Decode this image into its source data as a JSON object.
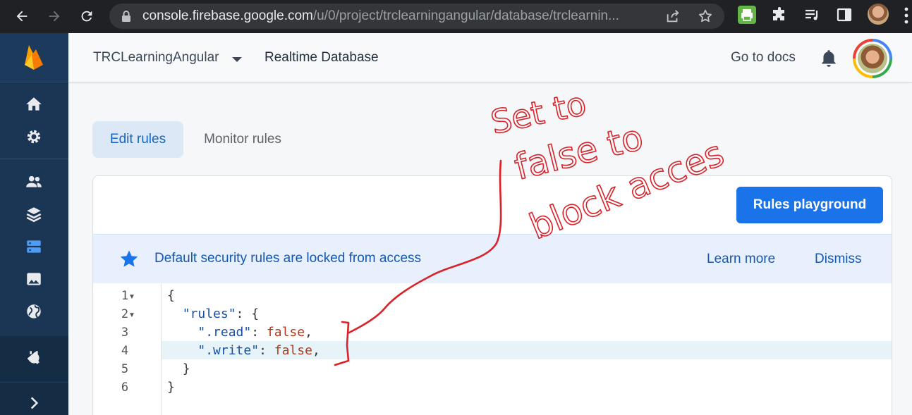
{
  "browser": {
    "url_host": "console.firebase.google.com",
    "url_path": "/u/0/project/trclearningangular/database/trclearnin..."
  },
  "header": {
    "project_name": "TRCLearningAngular",
    "section": "Realtime Database",
    "docs_link": "Go to docs"
  },
  "tabs": [
    {
      "label": "Edit rules",
      "active": true
    },
    {
      "label": "Monitor rules",
      "active": false
    }
  ],
  "card": {
    "playground_button": "Rules playground",
    "banner": {
      "message": "Default security rules are locked from access",
      "learn_more": "Learn more",
      "dismiss": "Dismiss"
    }
  },
  "editor": {
    "line_numbers": [
      "1",
      "2",
      "3",
      "4",
      "5",
      "6"
    ],
    "lines": [
      {
        "text": "{"
      },
      {
        "key": "\"rules\"",
        "rest": ": {"
      },
      {
        "key": "\".read\"",
        "sep": ": ",
        "value": "false",
        "tail": ","
      },
      {
        "key": "\".write\"",
        "sep": ": ",
        "value": "false",
        "tail": ","
      },
      {
        "text": "}"
      },
      {
        "text": "}"
      }
    ],
    "highlighted_line": 4
  },
  "annotation": {
    "line1": "Set to",
    "line2": "false to",
    "line3": "block acces"
  },
  "colors": {
    "sidebar": "#1a3654",
    "primary": "#1a73e8",
    "banner_bg": "#e8f0fe",
    "annotation_ink": "#d9232a"
  }
}
